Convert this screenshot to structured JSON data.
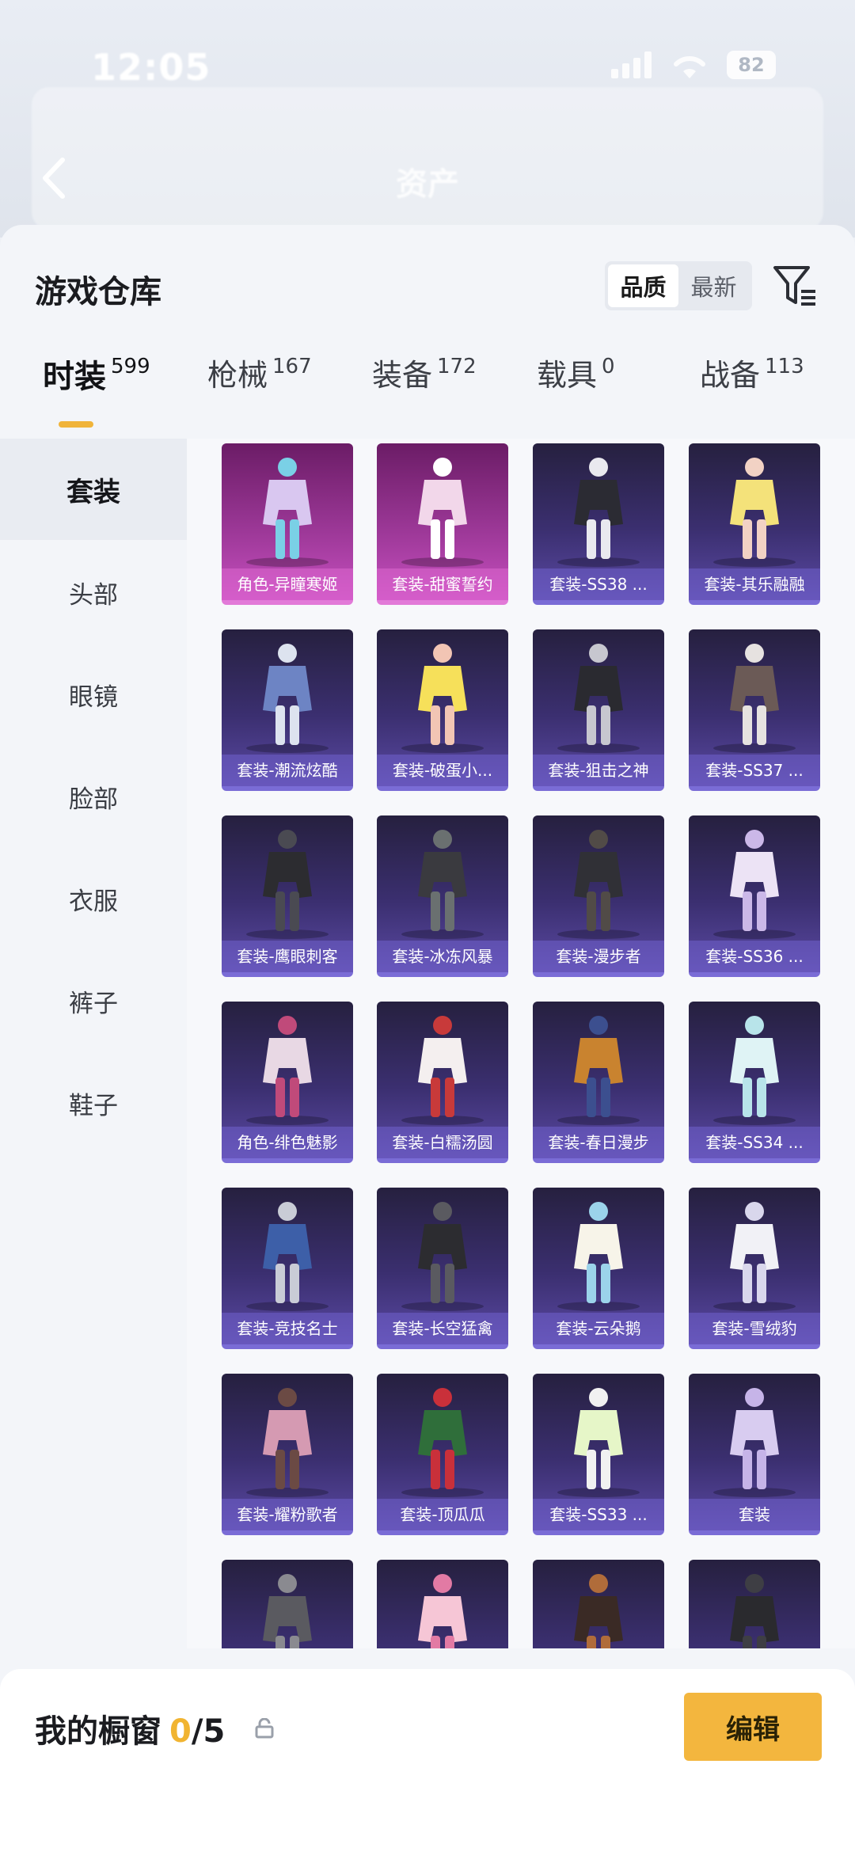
{
  "status_bar": {
    "time": "12:05",
    "battery": "82"
  },
  "header": {
    "title": "资产"
  },
  "panel": {
    "title": "游戏仓库",
    "sort_options": [
      "品质",
      "最新"
    ],
    "active_sort": "品质"
  },
  "tabs": [
    {
      "label": "时装",
      "count": "599",
      "active": true
    },
    {
      "label": "枪械",
      "count": "167",
      "active": false
    },
    {
      "label": "装备",
      "count": "172",
      "active": false
    },
    {
      "label": "载具",
      "count": "0",
      "active": false
    },
    {
      "label": "战备",
      "count": "113",
      "active": false
    }
  ],
  "side_nav": [
    {
      "label": "套装",
      "active": true
    },
    {
      "label": "头部",
      "active": false
    },
    {
      "label": "眼镜",
      "active": false
    },
    {
      "label": "脸部",
      "active": false
    },
    {
      "label": "衣服",
      "active": false
    },
    {
      "label": "裤子",
      "active": false
    },
    {
      "label": "鞋子",
      "active": false
    }
  ],
  "items": [
    {
      "label": "角色-异瞳寒姬",
      "rarity": "pink"
    },
    {
      "label": "套装-甜蜜誓约",
      "rarity": "pink"
    },
    {
      "label": "套装-SS38 ...",
      "rarity": "purple"
    },
    {
      "label": "套装-其乐融融",
      "rarity": "purple"
    },
    {
      "label": "套装-潮流炫酷",
      "rarity": "purple"
    },
    {
      "label": "套装-破蛋小...",
      "rarity": "purple"
    },
    {
      "label": "套装-狙击之神",
      "rarity": "purple"
    },
    {
      "label": "套装-SS37 ...",
      "rarity": "purple"
    },
    {
      "label": "套装-鹰眼刺客",
      "rarity": "purple"
    },
    {
      "label": "套装-冰冻风暴",
      "rarity": "purple"
    },
    {
      "label": "套装-漫步者",
      "rarity": "purple"
    },
    {
      "label": "套装-SS36 ...",
      "rarity": "purple"
    },
    {
      "label": "角色-绯色魅影",
      "rarity": "purple"
    },
    {
      "label": "套装-白糯汤圆",
      "rarity": "purple"
    },
    {
      "label": "套装-春日漫步",
      "rarity": "purple"
    },
    {
      "label": "套装-SS34 ...",
      "rarity": "purple"
    },
    {
      "label": "套装-竞技名士",
      "rarity": "purple"
    },
    {
      "label": "套装-长空猛禽",
      "rarity": "purple"
    },
    {
      "label": "套装-云朵鹅",
      "rarity": "purple"
    },
    {
      "label": "套装-雪绒豹",
      "rarity": "purple"
    },
    {
      "label": "套装-耀粉歌者",
      "rarity": "purple"
    },
    {
      "label": "套装-顶瓜瓜",
      "rarity": "purple"
    },
    {
      "label": "套装-SS33 ...",
      "rarity": "purple"
    },
    {
      "label": "套装",
      "rarity": "purple"
    },
    {
      "label": "",
      "rarity": "purple"
    },
    {
      "label": "",
      "rarity": "purple"
    },
    {
      "label": "",
      "rarity": "purple"
    },
    {
      "label": "",
      "rarity": "purple"
    }
  ],
  "bottom_bar": {
    "label": "我的橱窗",
    "count": "0",
    "separator": "/",
    "total": "5",
    "edit_label": "编辑"
  },
  "colors": {
    "accent": "#f3b63e",
    "card_purple": "#3b2f70",
    "card_pink": "#a03a9b"
  },
  "icons": [
    "back-arrow-icon",
    "mute-bell-icon",
    "signal-icon",
    "wifi-icon",
    "filter-icon",
    "share-icon",
    "lock-icon"
  ]
}
